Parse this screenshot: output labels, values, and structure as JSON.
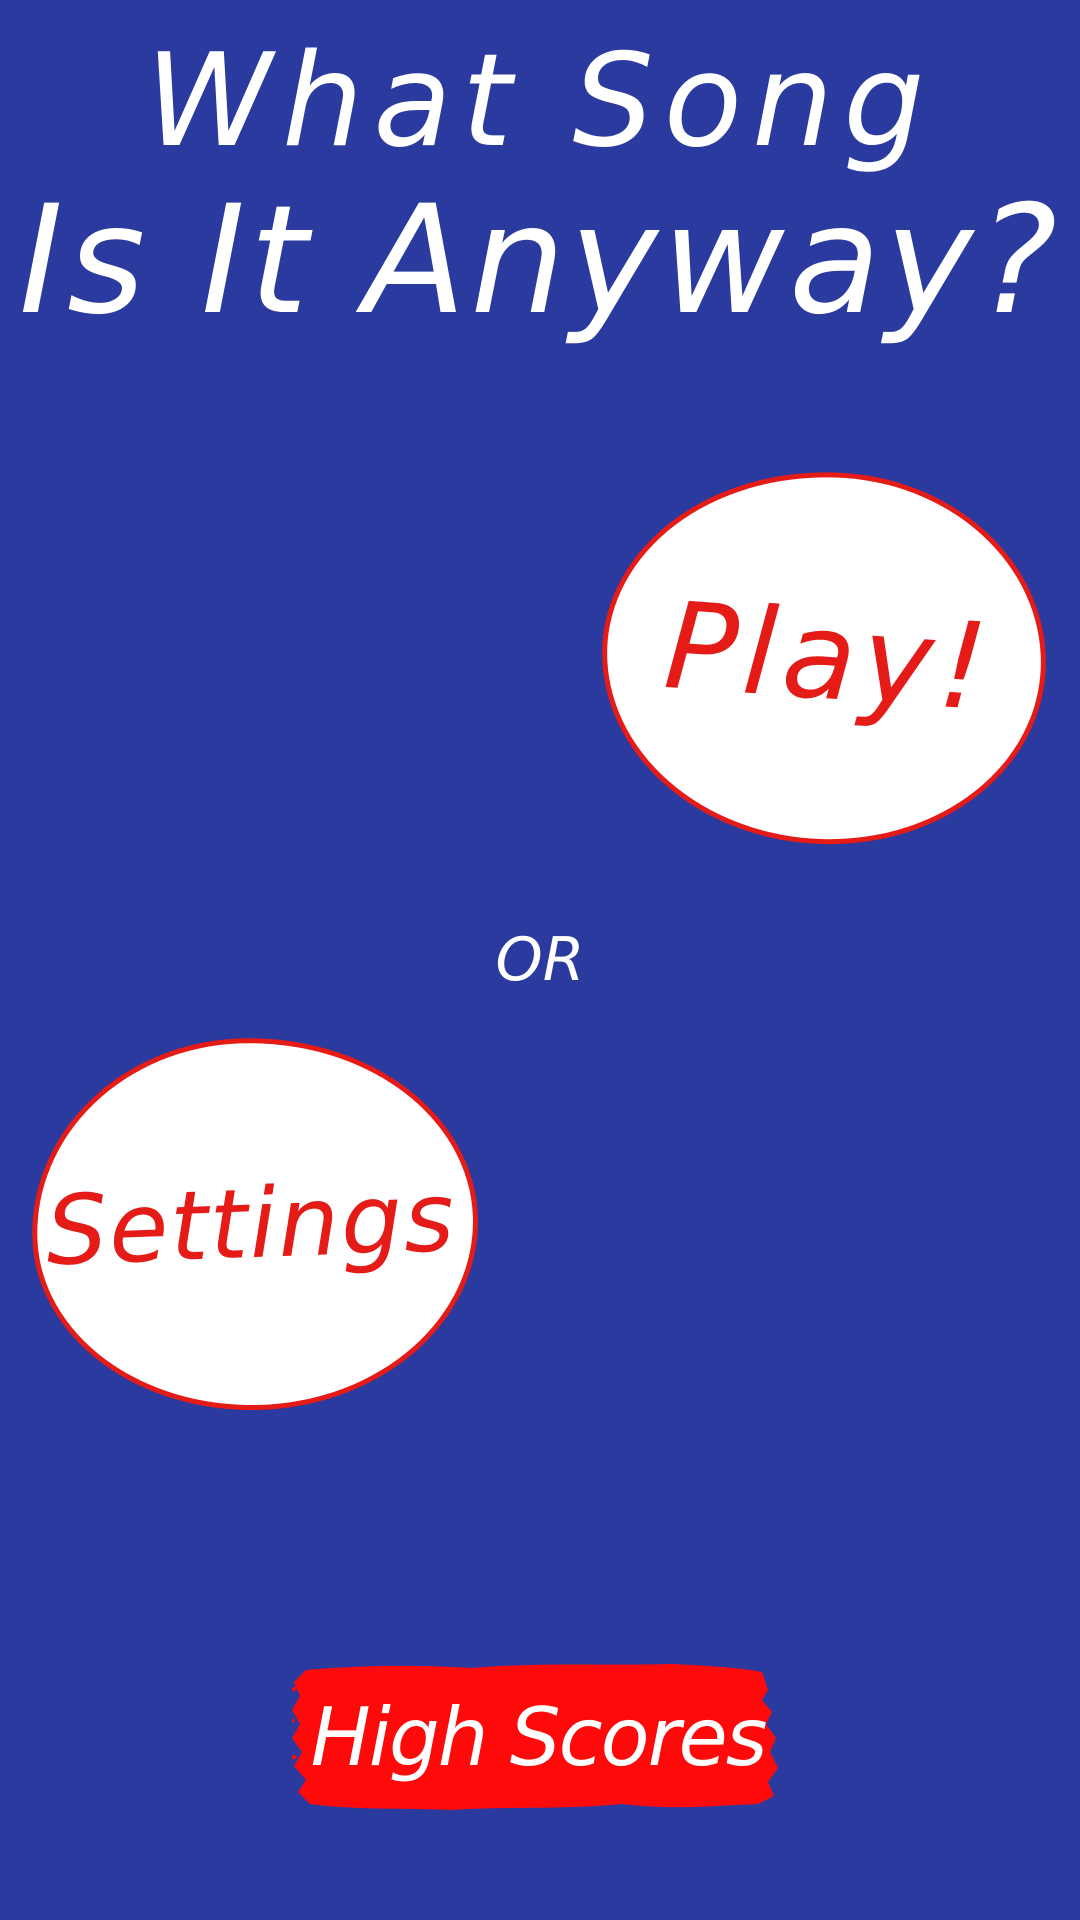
{
  "title": {
    "line1": "What Song",
    "line2": "Is It Anyway?"
  },
  "menu": {
    "play_label": "Play!",
    "separator_label": "OR",
    "settings_label": "Settings",
    "high_scores_label": "High Scores"
  },
  "colors": {
    "background": "#2b3a9e",
    "accent_red": "#e41b17",
    "bubble_fill": "#ffffff",
    "title_text": "#ffffff"
  }
}
